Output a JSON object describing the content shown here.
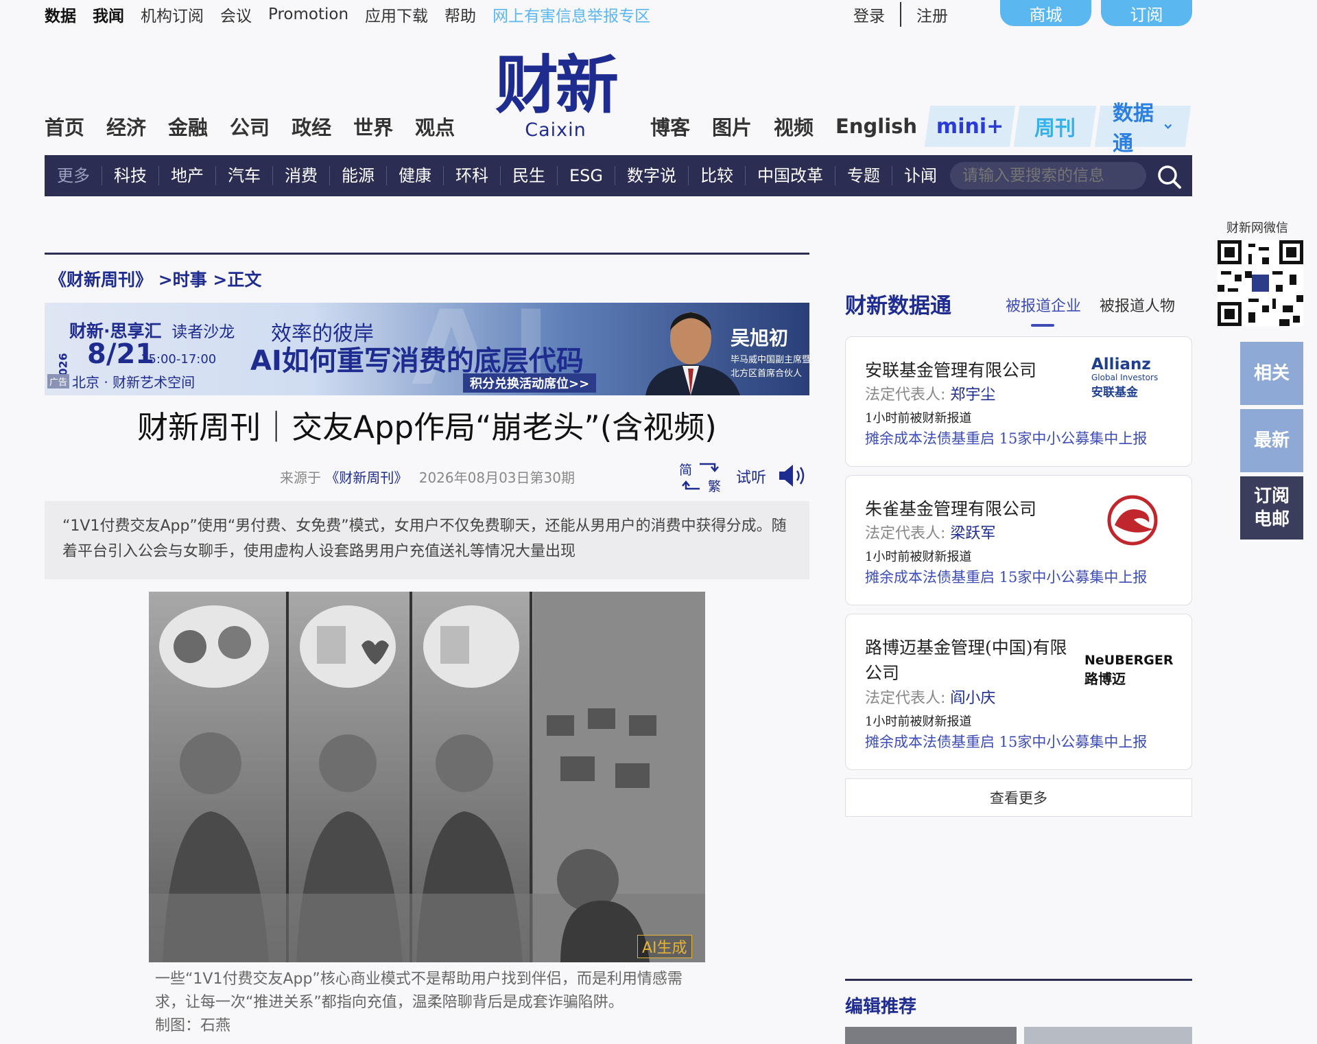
{
  "topbar": {
    "links": [
      "数据",
      "我闻",
      "机构订阅",
      "会议",
      "Promotion",
      "应用下载",
      "帮助"
    ],
    "report_link": "网上有害信息举报专区",
    "login": "登录",
    "register": "注册",
    "mall": "商城",
    "subscribe": "订阅"
  },
  "logo": {
    "cn": "财新",
    "en": "Caixin"
  },
  "main_nav": {
    "left": [
      "首页",
      "经济",
      "金融",
      "公司",
      "政经",
      "世界",
      "观点"
    ],
    "right": [
      "博客",
      "图片",
      "视频",
      "English"
    ],
    "tabs": [
      "mini+",
      "周刊",
      "数据通"
    ]
  },
  "sub_nav": {
    "items": [
      "更多",
      "科技",
      "地产",
      "汽车",
      "消费",
      "能源",
      "健康",
      "环科",
      "民生",
      "ESG",
      "数字说",
      "比较",
      "中国改革",
      "专题",
      "讣闻"
    ],
    "search_placeholder": "请输入要搜索的信息"
  },
  "article": {
    "breadcrumb": [
      "《财新周刊》",
      ">时事",
      ">正文"
    ],
    "banner": {
      "brand": "财新·思享汇",
      "event": "读者沙龙",
      "tagline": "效率的彼岸",
      "headline": "AI如何重写消费的底层代码",
      "year": "2026",
      "date": "8/21",
      "time": "15:00-17:00",
      "location": "北京 · 财新艺术空间",
      "ad_label": "广告",
      "cta": "积分兑换活动席位>>",
      "speaker_name": "吴旭初",
      "speaker_title_1": "毕马威中国副主席暨",
      "speaker_title_2": "北方区首席合伙人"
    },
    "title": "财新周刊｜交友App作局“崩老头”(含视频)",
    "source_prefix": "来源于",
    "source": "《财新周刊》",
    "date": "2026年08月03日第30期",
    "simp_trad_top": "简",
    "simp_trad_bottom": "繁",
    "listen": "试听",
    "summary": "“1V1付费交友App”使用“男付费、女免费”模式，女用户不仅免费聊天，还能从男用户的消费中获得分成。随着平台引入公会与女聊手，使用虚构人设套路男用户充值送礼等情况大量出现",
    "image_tag": "AI生成",
    "caption": "一些“1V1付费交友App”核心商业模式不是帮助用户找到伴侣，而是利用情感需求，让每一次“推进关系”都指向充值，温柔陪聊背后是成套诈骗陷阱。",
    "credit": "制图：石燕"
  },
  "data_tong": {
    "title": "财新数据通",
    "tabs": [
      "被报道企业",
      "被报道人物"
    ],
    "active_tab": 0,
    "cards": [
      {
        "company": "安联基金管理有限公司",
        "rep_label": "法定代表人:",
        "rep": "郑宇尘",
        "when": "1小时前被财新报道",
        "news": "摊余成本法债基重启 15家中小公募集中上报",
        "logo": "allianz",
        "logo_text": [
          "Allianz",
          "Global Investors",
          "安联基金"
        ]
      },
      {
        "company": "朱雀基金管理有限公司",
        "rep_label": "法定代表人:",
        "rep": "梁跃军",
        "when": "1小时前被财新报道",
        "news": "摊余成本法债基重启 15家中小公募集中上报",
        "logo": "suzaku-bird",
        "logo_text": []
      },
      {
        "company": "路博迈基金管理(中国)有限公司",
        "rep_label": "法定代表人:",
        "rep": "阎小庆",
        "when": "1小时前被财新报道",
        "news": "摊余成本法债基重启 15家中小公募集中上报",
        "logo": "neuberger",
        "logo_text": [
          "NeUBERGER",
          "路博迈"
        ]
      }
    ],
    "see_more": "查看更多"
  },
  "editor_pick": {
    "title": "编辑推荐"
  },
  "side": {
    "qr_label": "财新网微信",
    "buttons": [
      "相关",
      "最新",
      "订阅\n电邮"
    ]
  },
  "colors": {
    "brand_navy": "#1e2b8f",
    "subnav_bg": "#2b2d52",
    "accent_blue": "#5bb7ef",
    "link_blue": "#3d4db5",
    "side_btn_blue": "#8ea9d6",
    "side_btn_dark": "#3a3d5c"
  }
}
